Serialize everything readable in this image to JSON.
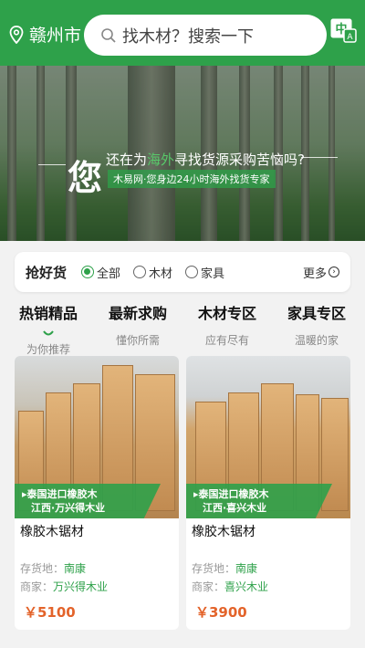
{
  "header": {
    "city": "赣州市",
    "search_placeholder": "找木材？搜索一下",
    "lang_icon": "translate-icon"
  },
  "banner": {
    "big_char": "您",
    "line1_pre": "还在为",
    "line1_hl": "海外",
    "line1_post": "寻找货源采购苦恼吗?",
    "line2": "木易网·您身边24小时海外找货专家"
  },
  "filter": {
    "title": "抢好货",
    "options": [
      "全部",
      "木材",
      "家具"
    ],
    "selected": "全部",
    "more": "更多"
  },
  "tabs": [
    {
      "title": "热销精品",
      "sub": "为你推荐",
      "active": true
    },
    {
      "title": "最新求购",
      "sub": "懂你所需",
      "active": false
    },
    {
      "title": "木材专区",
      "sub": "应有尽有",
      "active": false
    },
    {
      "title": "家具专区",
      "sub": "温暖的家",
      "active": false
    }
  ],
  "products": [
    {
      "label1": "▸泰国进口橡胶木",
      "label2": "江西·万兴得木业",
      "name": "橡胶木锯材",
      "stock_label": "存货地：",
      "stock": "南康",
      "seller_label": "商家：",
      "seller": "万兴得木业",
      "price": "￥5100"
    },
    {
      "label1": "▸泰国进口橡胶木",
      "label2": "江西·喜兴木业",
      "name": "橡胶木锯材",
      "stock_label": "存货地：",
      "stock": "南康",
      "seller_label": "商家：",
      "seller": "喜兴木业",
      "price": "￥3900"
    }
  ],
  "colors": {
    "brand": "#2ea14a",
    "price": "#e3632a"
  }
}
